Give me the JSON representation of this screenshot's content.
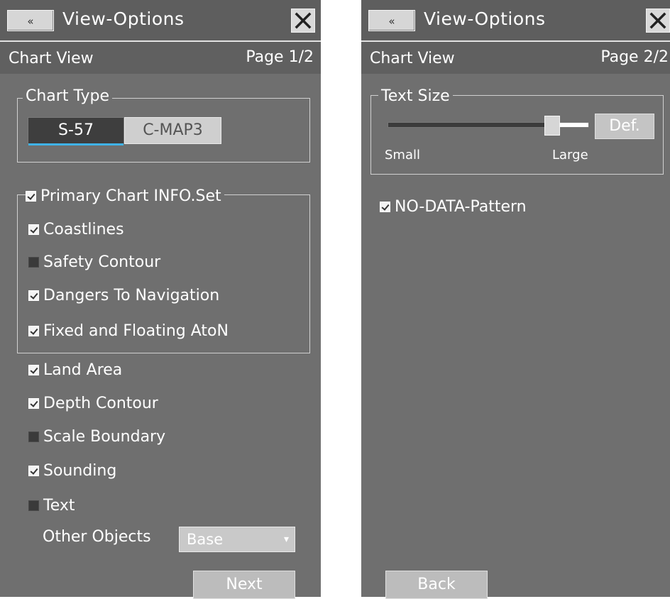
{
  "left": {
    "title": "View-Options",
    "back_glyph": "«",
    "close_glyph": "✕",
    "view_name": "Chart View",
    "page": "Page 1/2",
    "chart_type": {
      "label": "Chart Type",
      "options": [
        "S-57",
        "C-MAP3"
      ],
      "selected": "S-57"
    },
    "primary_set": {
      "label": "Primary Chart INFO.Set",
      "checked": true,
      "items": [
        {
          "label": "Coastlines",
          "checked": true
        },
        {
          "label": "Safety Contour",
          "checked": false
        },
        {
          "label": "Dangers To Navigation",
          "checked": true
        },
        {
          "label": "Fixed and Floating AtoN",
          "checked": true
        }
      ]
    },
    "items": [
      {
        "label": "Land Area",
        "checked": true
      },
      {
        "label": "Depth Contour",
        "checked": true
      },
      {
        "label": "Scale Boundary",
        "checked": false
      },
      {
        "label": "Sounding",
        "checked": true
      },
      {
        "label": "Text",
        "checked": false
      }
    ],
    "other_objects": {
      "label": "Other Objects",
      "value": "Base"
    },
    "next_label": "Next"
  },
  "right": {
    "title": "View-Options",
    "back_glyph": "«",
    "close_glyph": "✕",
    "view_name": "Chart View",
    "page": "Page 2/2",
    "text_size": {
      "label": "Text Size",
      "level": 0.82,
      "min_label": "Small",
      "max_label": "Large",
      "default_label": "Def."
    },
    "no_data_pattern": {
      "label": "NO-DATA-Pattern",
      "checked": true
    },
    "back_label": "Back"
  },
  "colors": {
    "panel_bg": "#6f6f6f",
    "header_bg": "#5e5e5e",
    "accent": "#3fb3e8"
  },
  "icons": [
    "double-chevron-left-icon",
    "close-x-icon",
    "checkbox-icon",
    "dropdown-arrow-icon"
  ]
}
